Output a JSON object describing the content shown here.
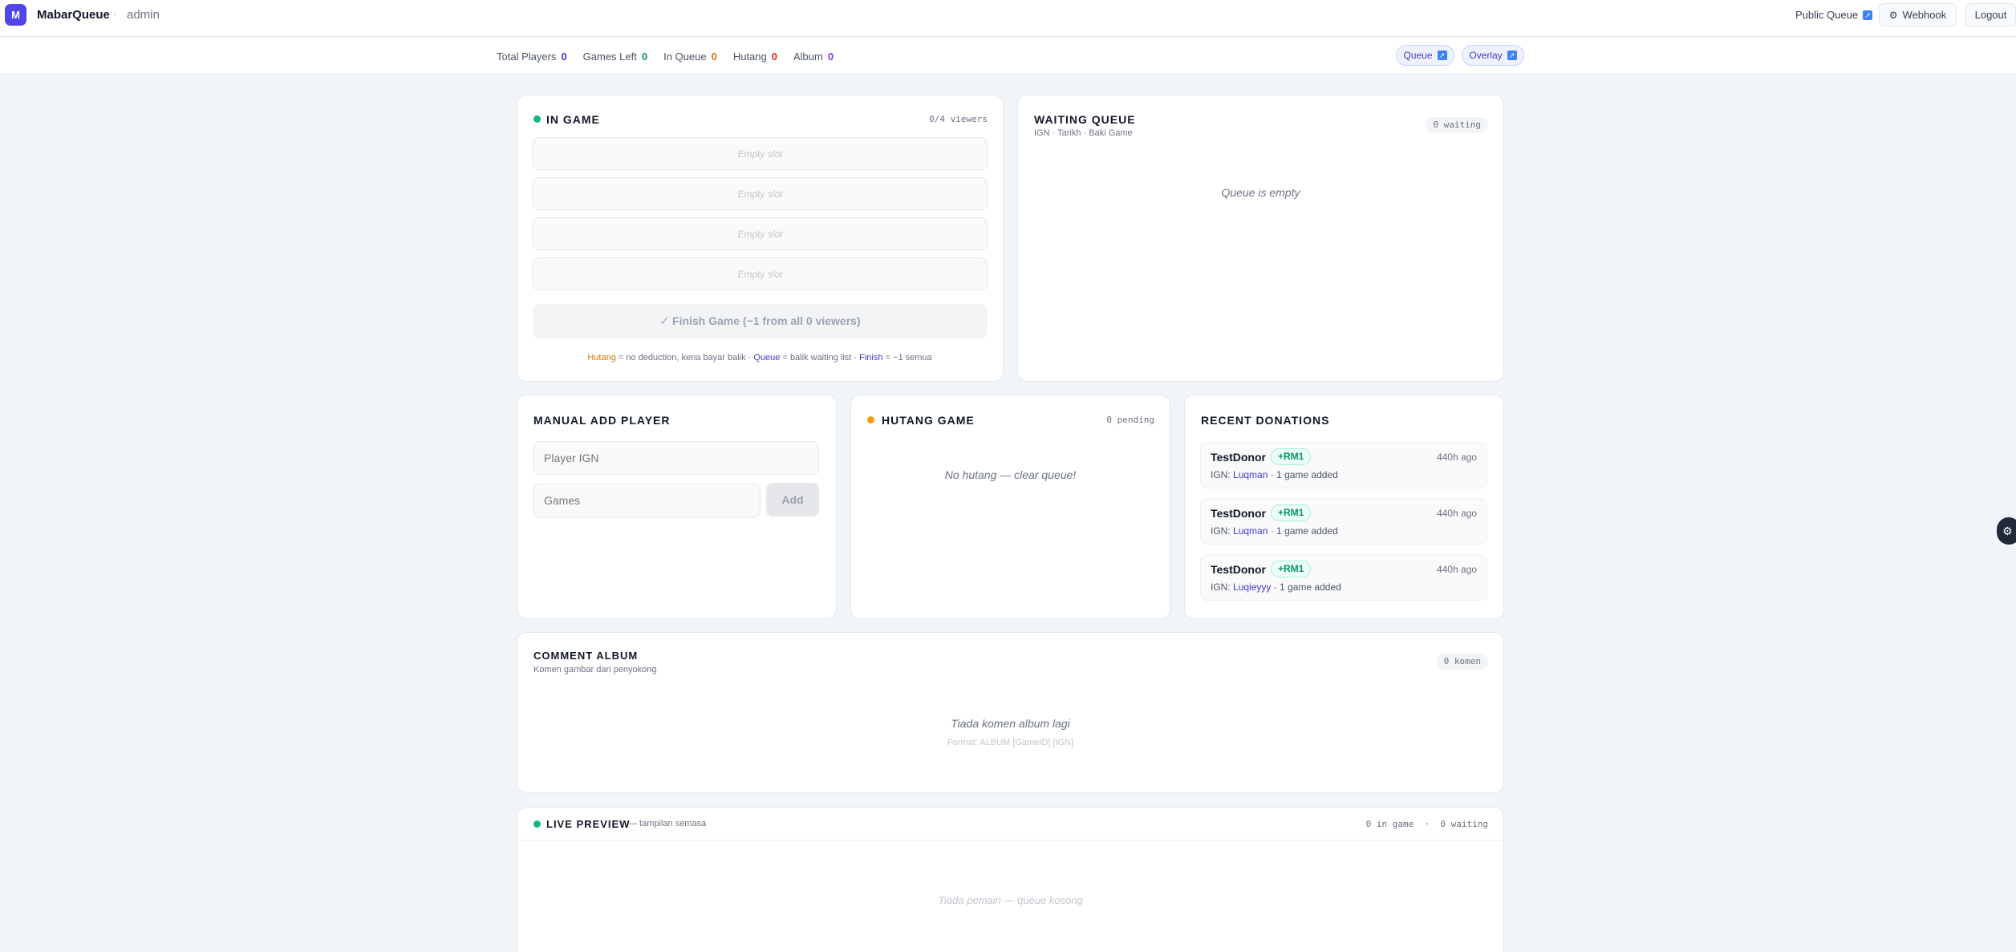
{
  "header": {
    "logo_letter": "M",
    "brand": "MabarQueue",
    "separator": "·",
    "role": "admin",
    "public_queue_label": "Public Queue",
    "webhook_label": "Webhook",
    "logout_label": "Logout"
  },
  "stats": [
    {
      "label": "Total Players",
      "value": "0",
      "color": "#4338ca"
    },
    {
      "label": "Games Left",
      "value": "0",
      "color": "#059669"
    },
    {
      "label": "In Queue",
      "value": "0",
      "color": "#d97706"
    },
    {
      "label": "Hutang",
      "value": "0",
      "color": "#dc2626"
    },
    {
      "label": "Album",
      "value": "0",
      "color": "#9333ea"
    }
  ],
  "links": {
    "queue_label": "Queue",
    "overlay_label": "Overlay"
  },
  "in_game": {
    "title": "IN GAME",
    "viewers": "0/4 viewers",
    "slots": [
      "Empty slot",
      "Empty slot",
      "Empty slot",
      "Empty slot"
    ],
    "finish_label": "✓ Finish Game (−1 from all 0 viewers)",
    "hint": {
      "hutang": "Hutang",
      "hutang_desc": " = no deduction, kena bayar balik · ",
      "queue": "Queue",
      "queue_desc": " = balik waiting list · ",
      "finish": "Finish",
      "finish_desc": " = −1 semua"
    }
  },
  "waiting_queue": {
    "title": "WAITING QUEUE",
    "subtitle": "IGN · Tarikh · Baki Game",
    "badge": "0 waiting",
    "empty": "Queue is empty"
  },
  "manual_add": {
    "title": "MANUAL ADD PLAYER",
    "ign_placeholder": "Player IGN",
    "games_placeholder": "Games",
    "add_label": "Add"
  },
  "hutang_game": {
    "title": "HUTANG GAME",
    "badge": "0 pending",
    "empty": "No hutang — clear queue!"
  },
  "donations": {
    "title": "RECENT DONATIONS",
    "ign_prefix": "IGN: ",
    "items": [
      {
        "name": "TestDonor",
        "amount": "+RM1",
        "time": "440h ago",
        "ign": "Luqman",
        "detail": " · 1 game added"
      },
      {
        "name": "TestDonor",
        "amount": "+RM1",
        "time": "440h ago",
        "ign": "Luqman",
        "detail": " · 1 game added"
      },
      {
        "name": "TestDonor",
        "amount": "+RM1",
        "time": "440h ago",
        "ign": "Luqieyyy",
        "detail": " · 1 game added"
      }
    ]
  },
  "album": {
    "title": "COMMENT ALBUM",
    "subtitle": "Komen gambar dari penyokong",
    "badge": "0 komen",
    "empty": "Tiada komen album lagi",
    "format": "Format: ALBUM [GameID] [IGN]"
  },
  "preview": {
    "title": "LIVE PREVIEW",
    "subtitle": "— tampilan semasa",
    "status": "0 in game  ·  0 waiting",
    "empty": "Tiada pemain — queue kosong"
  },
  "colors": {
    "accent": "#4f46e5",
    "success": "#10b981",
    "warning": "#f59e0b"
  }
}
